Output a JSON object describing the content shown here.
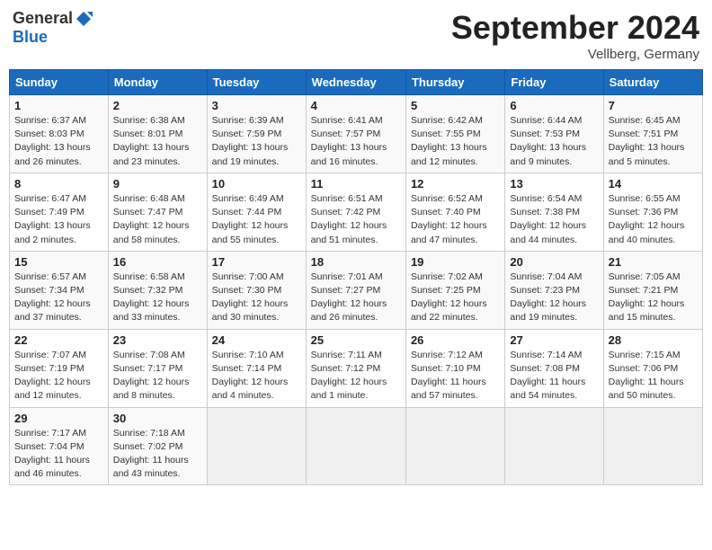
{
  "header": {
    "logo_general": "General",
    "logo_blue": "Blue",
    "month_title": "September 2024",
    "location": "Vellberg, Germany"
  },
  "calendar": {
    "days_of_week": [
      "Sunday",
      "Monday",
      "Tuesday",
      "Wednesday",
      "Thursday",
      "Friday",
      "Saturday"
    ],
    "weeks": [
      [
        {
          "day": "",
          "empty": true
        },
        {
          "day": "",
          "empty": true
        },
        {
          "day": "",
          "empty": true
        },
        {
          "day": "",
          "empty": true
        },
        {
          "day": "",
          "empty": true
        },
        {
          "day": "",
          "empty": true
        },
        {
          "day": "",
          "empty": true
        }
      ],
      [
        {
          "day": "1",
          "sunrise": "6:37 AM",
          "sunset": "8:03 PM",
          "daylight": "Daylight: 13 hours and 26 minutes."
        },
        {
          "day": "2",
          "sunrise": "6:38 AM",
          "sunset": "8:01 PM",
          "daylight": "Daylight: 13 hours and 23 minutes."
        },
        {
          "day": "3",
          "sunrise": "6:39 AM",
          "sunset": "7:59 PM",
          "daylight": "Daylight: 13 hours and 19 minutes."
        },
        {
          "day": "4",
          "sunrise": "6:41 AM",
          "sunset": "7:57 PM",
          "daylight": "Daylight: 13 hours and 16 minutes."
        },
        {
          "day": "5",
          "sunrise": "6:42 AM",
          "sunset": "7:55 PM",
          "daylight": "Daylight: 13 hours and 12 minutes."
        },
        {
          "day": "6",
          "sunrise": "6:44 AM",
          "sunset": "7:53 PM",
          "daylight": "Daylight: 13 hours and 9 minutes."
        },
        {
          "day": "7",
          "sunrise": "6:45 AM",
          "sunset": "7:51 PM",
          "daylight": "Daylight: 13 hours and 5 minutes."
        }
      ],
      [
        {
          "day": "8",
          "sunrise": "6:47 AM",
          "sunset": "7:49 PM",
          "daylight": "Daylight: 13 hours and 2 minutes."
        },
        {
          "day": "9",
          "sunrise": "6:48 AM",
          "sunset": "7:47 PM",
          "daylight": "Daylight: 12 hours and 58 minutes."
        },
        {
          "day": "10",
          "sunrise": "6:49 AM",
          "sunset": "7:44 PM",
          "daylight": "Daylight: 12 hours and 55 minutes."
        },
        {
          "day": "11",
          "sunrise": "6:51 AM",
          "sunset": "7:42 PM",
          "daylight": "Daylight: 12 hours and 51 minutes."
        },
        {
          "day": "12",
          "sunrise": "6:52 AM",
          "sunset": "7:40 PM",
          "daylight": "Daylight: 12 hours and 47 minutes."
        },
        {
          "day": "13",
          "sunrise": "6:54 AM",
          "sunset": "7:38 PM",
          "daylight": "Daylight: 12 hours and 44 minutes."
        },
        {
          "day": "14",
          "sunrise": "6:55 AM",
          "sunset": "7:36 PM",
          "daylight": "Daylight: 12 hours and 40 minutes."
        }
      ],
      [
        {
          "day": "15",
          "sunrise": "6:57 AM",
          "sunset": "7:34 PM",
          "daylight": "Daylight: 12 hours and 37 minutes."
        },
        {
          "day": "16",
          "sunrise": "6:58 AM",
          "sunset": "7:32 PM",
          "daylight": "Daylight: 12 hours and 33 minutes."
        },
        {
          "day": "17",
          "sunrise": "7:00 AM",
          "sunset": "7:30 PM",
          "daylight": "Daylight: 12 hours and 30 minutes."
        },
        {
          "day": "18",
          "sunrise": "7:01 AM",
          "sunset": "7:27 PM",
          "daylight": "Daylight: 12 hours and 26 minutes."
        },
        {
          "day": "19",
          "sunrise": "7:02 AM",
          "sunset": "7:25 PM",
          "daylight": "Daylight: 12 hours and 22 minutes."
        },
        {
          "day": "20",
          "sunrise": "7:04 AM",
          "sunset": "7:23 PM",
          "daylight": "Daylight: 12 hours and 19 minutes."
        },
        {
          "day": "21",
          "sunrise": "7:05 AM",
          "sunset": "7:21 PM",
          "daylight": "Daylight: 12 hours and 15 minutes."
        }
      ],
      [
        {
          "day": "22",
          "sunrise": "7:07 AM",
          "sunset": "7:19 PM",
          "daylight": "Daylight: 12 hours and 12 minutes."
        },
        {
          "day": "23",
          "sunrise": "7:08 AM",
          "sunset": "7:17 PM",
          "daylight": "Daylight: 12 hours and 8 minutes."
        },
        {
          "day": "24",
          "sunrise": "7:10 AM",
          "sunset": "7:14 PM",
          "daylight": "Daylight: 12 hours and 4 minutes."
        },
        {
          "day": "25",
          "sunrise": "7:11 AM",
          "sunset": "7:12 PM",
          "daylight": "Daylight: 12 hours and 1 minute."
        },
        {
          "day": "26",
          "sunrise": "7:12 AM",
          "sunset": "7:10 PM",
          "daylight": "Daylight: 11 hours and 57 minutes."
        },
        {
          "day": "27",
          "sunrise": "7:14 AM",
          "sunset": "7:08 PM",
          "daylight": "Daylight: 11 hours and 54 minutes."
        },
        {
          "day": "28",
          "sunrise": "7:15 AM",
          "sunset": "7:06 PM",
          "daylight": "Daylight: 11 hours and 50 minutes."
        }
      ],
      [
        {
          "day": "29",
          "sunrise": "7:17 AM",
          "sunset": "7:04 PM",
          "daylight": "Daylight: 11 hours and 46 minutes."
        },
        {
          "day": "30",
          "sunrise": "7:18 AM",
          "sunset": "7:02 PM",
          "daylight": "Daylight: 11 hours and 43 minutes."
        },
        {
          "day": "",
          "empty": true
        },
        {
          "day": "",
          "empty": true
        },
        {
          "day": "",
          "empty": true
        },
        {
          "day": "",
          "empty": true
        },
        {
          "day": "",
          "empty": true
        }
      ]
    ]
  }
}
